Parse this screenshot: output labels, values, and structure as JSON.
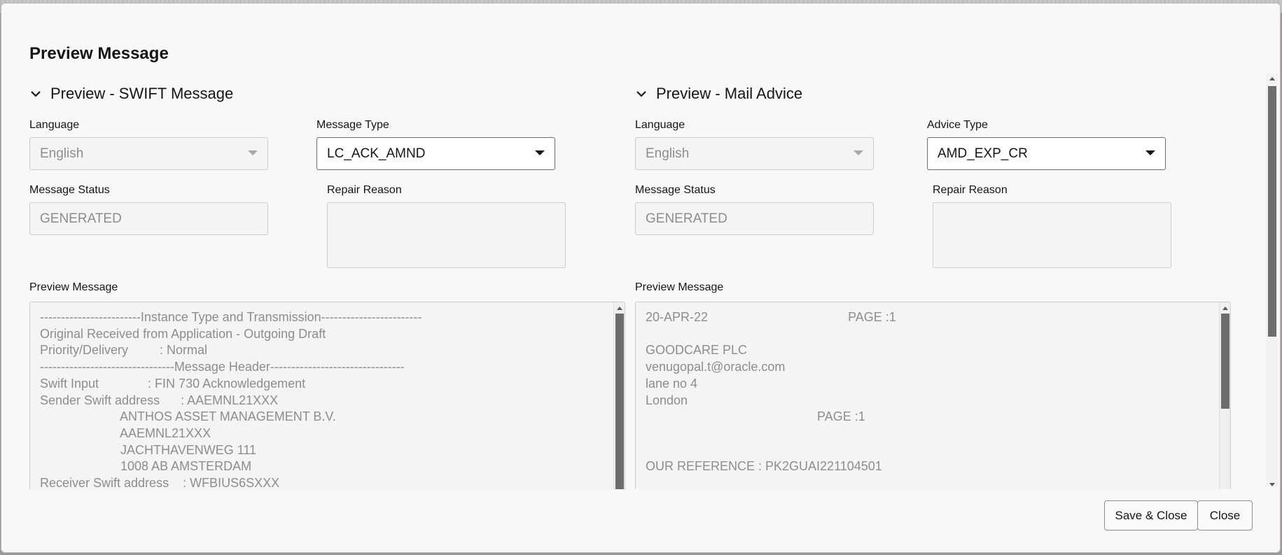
{
  "modal": {
    "title": "Preview Message"
  },
  "swift": {
    "header": "Preview - SWIFT Message",
    "language_label": "Language",
    "language_value": "English",
    "message_type_label": "Message Type",
    "message_type_value": "LC_ACK_AMND",
    "message_status_label": "Message Status",
    "message_status_value": "GENERATED",
    "repair_reason_label": "Repair Reason",
    "preview_label": "Preview Message",
    "preview_text": "------------------------Instance Type and Transmission------------------------\nOriginal Received from Application - Outgoing Draft\nPriority/Delivery         : Normal\n--------------------------------Message Header--------------------------------\nSwift Input              : FIN 730 Acknowledgement\nSender Swift address      : AAEMNL21XXX\n                       ANTHOS ASSET MANAGEMENT B.V.\n                       AAEMNL21XXX\n                       JACHTHAVENWEG 111\n                       1008 AB AMSTERDAM\nReceiver Swift address    : WFBIUS6SXXX"
  },
  "mail": {
    "header": "Preview - Mail Advice",
    "language_label": "Language",
    "language_value": "English",
    "advice_type_label": "Advice Type",
    "advice_type_value": "AMD_EXP_CR",
    "message_status_label": "Message Status",
    "message_status_value": "GENERATED",
    "repair_reason_label": "Repair Reason",
    "preview_label": "Preview Message",
    "preview_text": "20-APR-22                                        PAGE :1\n\nGOODCARE PLC\nvenugopal.t@oracle.com\nlane no 4\nLondon\n                                                 PAGE :1\n\n\nOUR REFERENCE : PK2GUAI221104501"
  },
  "footer": {
    "save_close_label": "Save & Close",
    "close_label": "Close"
  },
  "icons": {
    "section_toggle": "chevron-down-icon",
    "dropdown": "caret-down-icon"
  },
  "colors": {
    "modal_bg": "#f9f8f7",
    "text_primary": "#161513",
    "text_disabled": "#8e8d8b"
  }
}
